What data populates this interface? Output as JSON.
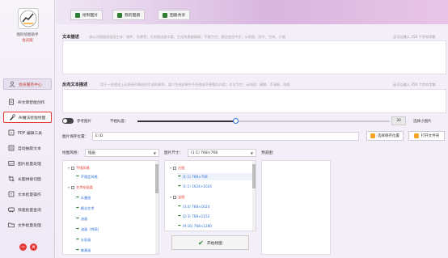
{
  "app": {
    "title": "图形绘图助手",
    "subtitle": "会员版"
  },
  "sidebar": {
    "user_label": "会员服务中心",
    "items": [
      {
        "label": "AI文章智能创作",
        "icon": "document-icon"
      },
      {
        "label": "AI魔法智能绘图",
        "icon": "paint-icon",
        "active": true
      },
      {
        "label": "PDF 编辑工具",
        "icon": "pdf-icon"
      },
      {
        "label": "自动抽取文本",
        "icon": "text-extract-icon"
      },
      {
        "label": "图片批量处理",
        "icon": "image-batch-icon"
      },
      {
        "label": "长图拼接切图",
        "icon": "crop-icon"
      },
      {
        "label": "文本批量操作",
        "icon": "text-batch-icon"
      },
      {
        "label": "快速批量查询",
        "icon": "query-icon"
      },
      {
        "label": "文件批量处理",
        "icon": "folder-batch-icon"
      }
    ]
  },
  "tabs": [
    {
      "label": "绘制图片"
    },
    {
      "label": "我的图册"
    },
    {
      "label": "图册共享"
    }
  ],
  "text_desc": {
    "label": "文本描述",
    "hint": "请以详细描述画面主体：物件、场景等；文本描述越丰富，生成效果越精确；不能为空；建议使用中文；示例图：雨中、竹林、小猫",
    "counter": "还可以输入 250 个字符字数"
  },
  "neg_desc": {
    "label": "反向文本描述",
    "hint": "用于一些描述上从原画中降低的生成的概率，减少生成结果中不合理或不想要的内容；也可为空；示例图：模糊、不清晰、残影",
    "counter": "还可以输入 250 个字符字数"
  },
  "ref": {
    "toggle_label": "参考图片",
    "strength_label": "不相似度：",
    "strength_value": "30",
    "strength_fraction": 0.39,
    "upload_label": "选择小图片"
  },
  "save": {
    "label": "图片保存位置：",
    "path": "E:\\D",
    "choose_label": "选择保存位置",
    "open_label": "打开文件夹"
  },
  "style": {
    "label": "绘图风格：",
    "value": "插画"
  },
  "size": {
    "label": "图片尺寸：",
    "value": "(1:1) 768×768"
  },
  "preview": {
    "label": "预览图："
  },
  "style_tree": [
    {
      "type": "cat",
      "label": "不限风格"
    },
    {
      "type": "item",
      "label": "不限定风格"
    },
    {
      "type": "cat",
      "label": "艺术绘画类"
    },
    {
      "type": "item",
      "label": "水墨画"
    },
    {
      "type": "item",
      "label": "概念艺术"
    },
    {
      "type": "item",
      "label": "油画"
    },
    {
      "type": "item",
      "label": "油画（梵高）"
    },
    {
      "type": "item",
      "label": "水彩画"
    },
    {
      "type": "item",
      "label": "像素画"
    }
  ],
  "size_tree": [
    {
      "type": "cat",
      "label": "方图"
    },
    {
      "type": "item",
      "label": "(1:1) 768×768"
    },
    {
      "type": "item",
      "label": "(1:1) 1024×1024"
    },
    {
      "type": "cat",
      "label": "竖图"
    },
    {
      "type": "item",
      "label": "(3:4) 768×1024"
    },
    {
      "type": "item",
      "label": "(2:3) 768×1152"
    },
    {
      "type": "item",
      "label": "(9:16) 768×1280"
    }
  ],
  "start_label": "开始绘图",
  "colors": {
    "accent": "#e53935",
    "link": "#2b6fd6",
    "green": "#2e7d32"
  }
}
